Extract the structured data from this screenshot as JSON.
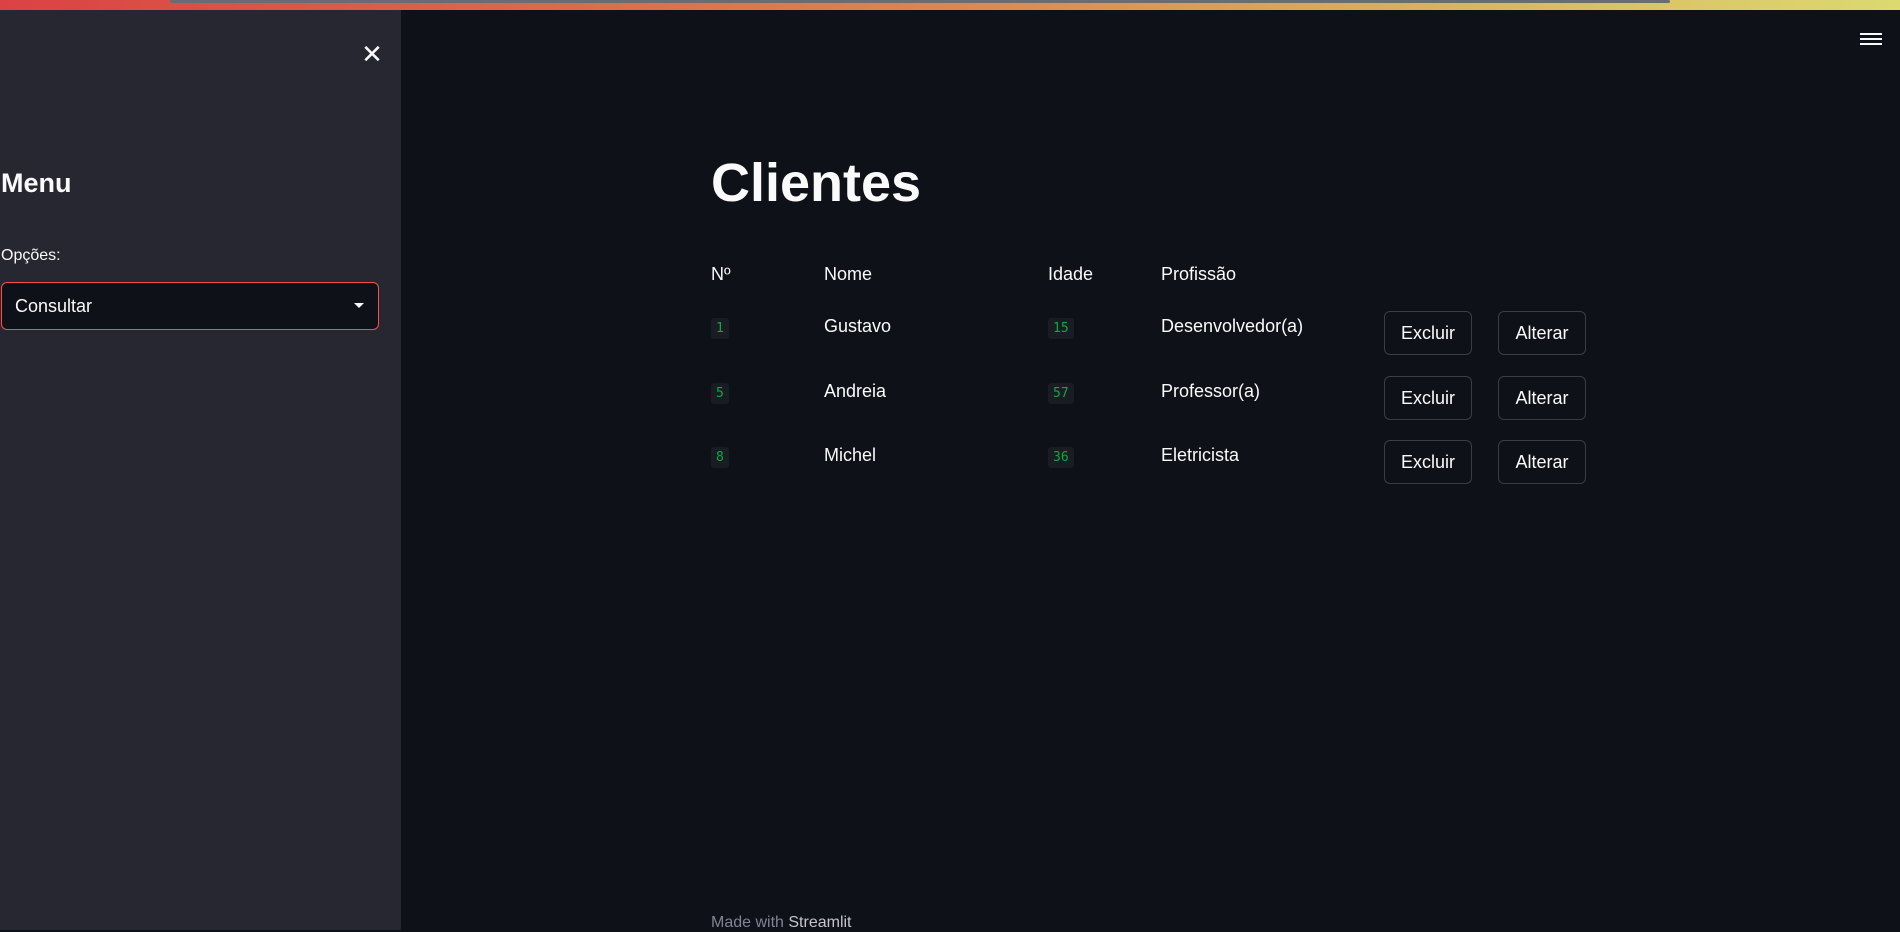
{
  "sidebar": {
    "title": "Menu",
    "options_label": "Opções:",
    "selected_option": "Consultar"
  },
  "main": {
    "title": "Clientes",
    "columns": [
      "Nº",
      "Nome",
      "Idade",
      "Profissão"
    ],
    "rows": [
      {
        "id": "1",
        "nome": "Gustavo",
        "idade": "15",
        "profissao": "Desenvolvedor(a)",
        "delete_label": "Excluir",
        "edit_label": "Alterar"
      },
      {
        "id": "5",
        "nome": "Andreia",
        "idade": "57",
        "profissao": "Professor(a)",
        "delete_label": "Excluir",
        "edit_label": "Alterar"
      },
      {
        "id": "8",
        "nome": "Michel",
        "idade": "36",
        "profissao": "Eletricista",
        "delete_label": "Excluir",
        "edit_label": "Alterar"
      }
    ]
  },
  "footer": {
    "prefix": "Made with",
    "brand": "Streamlit"
  },
  "icons": {
    "close": "close-icon",
    "menu": "hamburger-menu-icon",
    "dropdown": "chevron-down-icon"
  },
  "colors": {
    "accent": "#ff4b4b",
    "code_green": "#09ab3b",
    "background": "#0e1117",
    "sidebar": "#262730"
  }
}
